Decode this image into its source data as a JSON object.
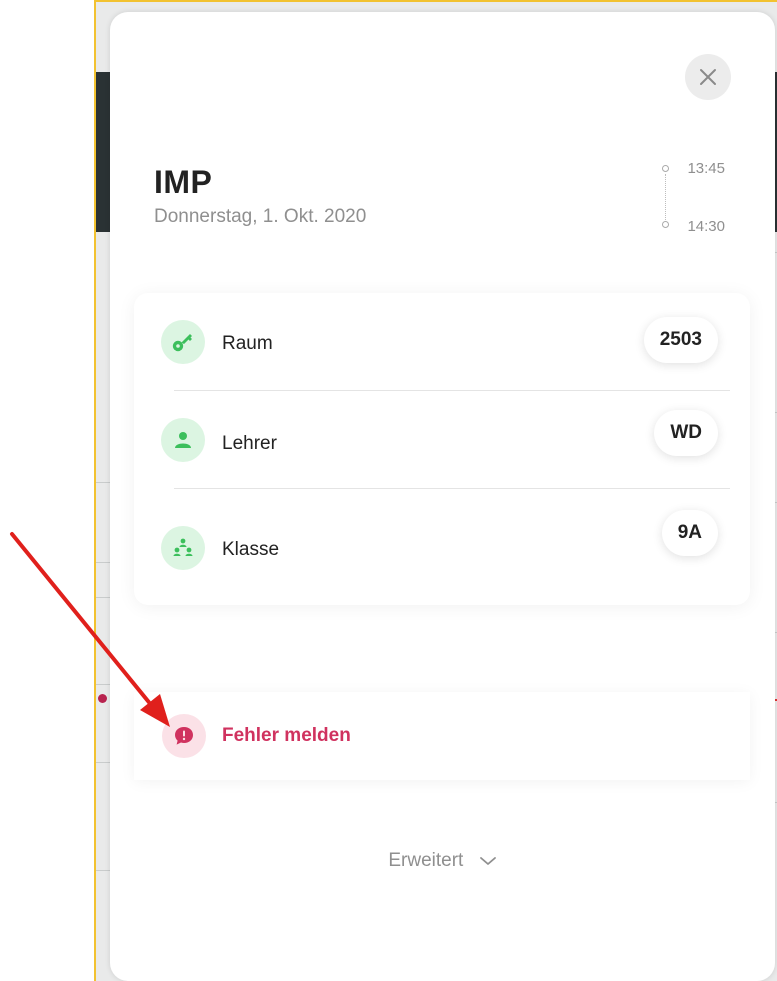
{
  "lesson": {
    "subject": "IMP",
    "date": "Donnerstag, 1. Okt. 2020",
    "time_start": "13:45",
    "time_end": "14:30"
  },
  "details": [
    {
      "label": "Raum",
      "value": "2503",
      "icon": "key-icon"
    },
    {
      "label": "Lehrer",
      "value": "WD",
      "icon": "person-icon"
    },
    {
      "label": "Klasse",
      "value": "9A",
      "icon": "group-icon"
    }
  ],
  "report": {
    "label": "Fehler melden",
    "icon": "alert-bubble-icon"
  },
  "advanced": {
    "label": "Erweitert",
    "icon": "chevron-down-icon"
  },
  "colors": {
    "accent_green": "#3cbf5c",
    "accent_red": "#d0325f",
    "annotation_arrow": "#e0201c"
  }
}
